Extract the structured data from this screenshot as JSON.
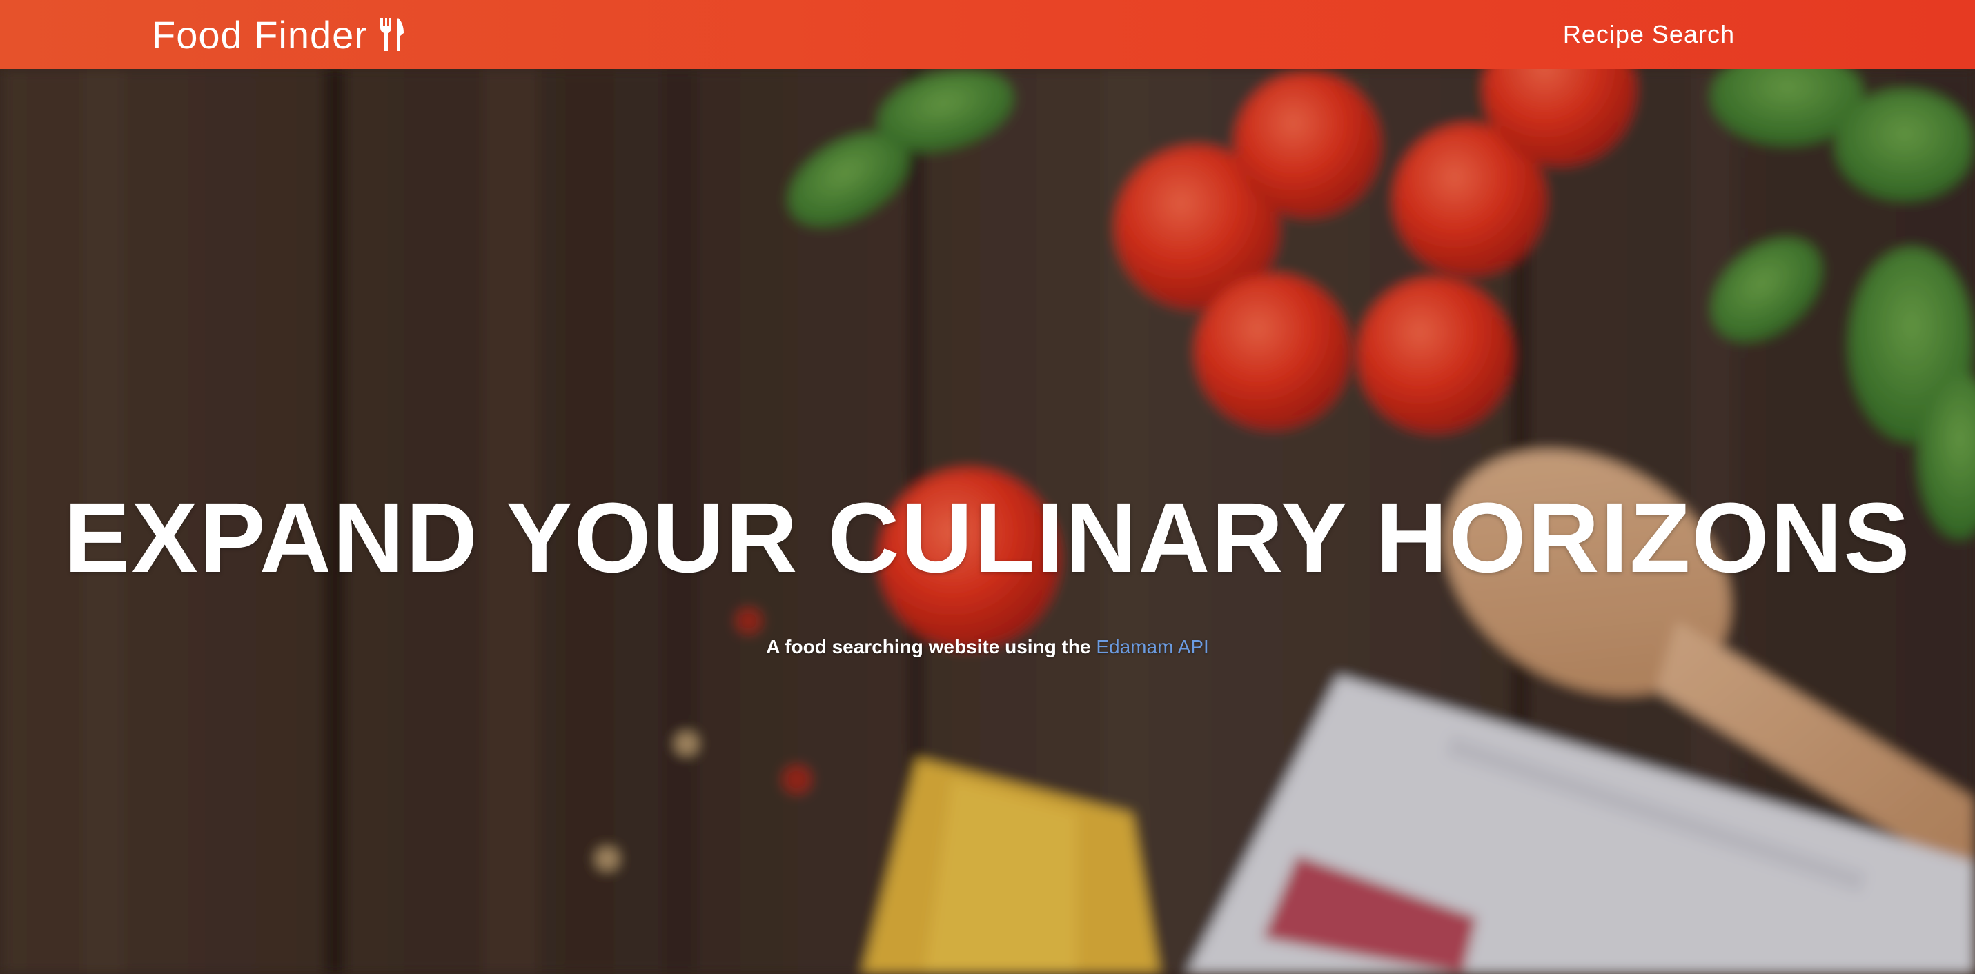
{
  "header": {
    "brand": "Food Finder",
    "brand_icon": "fork-knife-icon",
    "nav_link": "Recipe Search",
    "colors": {
      "start": "#e6522b",
      "end": "#e63a22"
    }
  },
  "hero": {
    "title": "EXPAND YOUR CULINARY HORIZONS",
    "subtitle_prefix": "A food searching website using the",
    "subtitle_link": "Edamam API",
    "link_color": "#6b9be0",
    "background": "blurred wooden table with tomatoes, basil, wooden spoon, spaghetti and kitchen towel"
  }
}
